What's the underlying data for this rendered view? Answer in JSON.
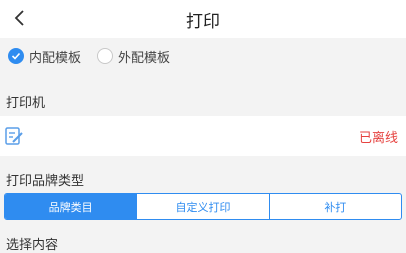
{
  "header": {
    "title": "打印"
  },
  "template": {
    "options": [
      {
        "label": "内配模板",
        "checked": true
      },
      {
        "label": "外配模板",
        "checked": false
      }
    ]
  },
  "printer": {
    "section_label": "打印机",
    "status": "已离线",
    "status_color": "#e64340"
  },
  "brand_type": {
    "section_label": "打印品牌类型",
    "tabs": [
      "品牌类目",
      "自定义打印",
      "补打"
    ],
    "active_index": 0
  },
  "select_content": {
    "section_label": "选择内容"
  },
  "colors": {
    "accent": "#2f8cf0",
    "background": "#f3f3f3"
  }
}
